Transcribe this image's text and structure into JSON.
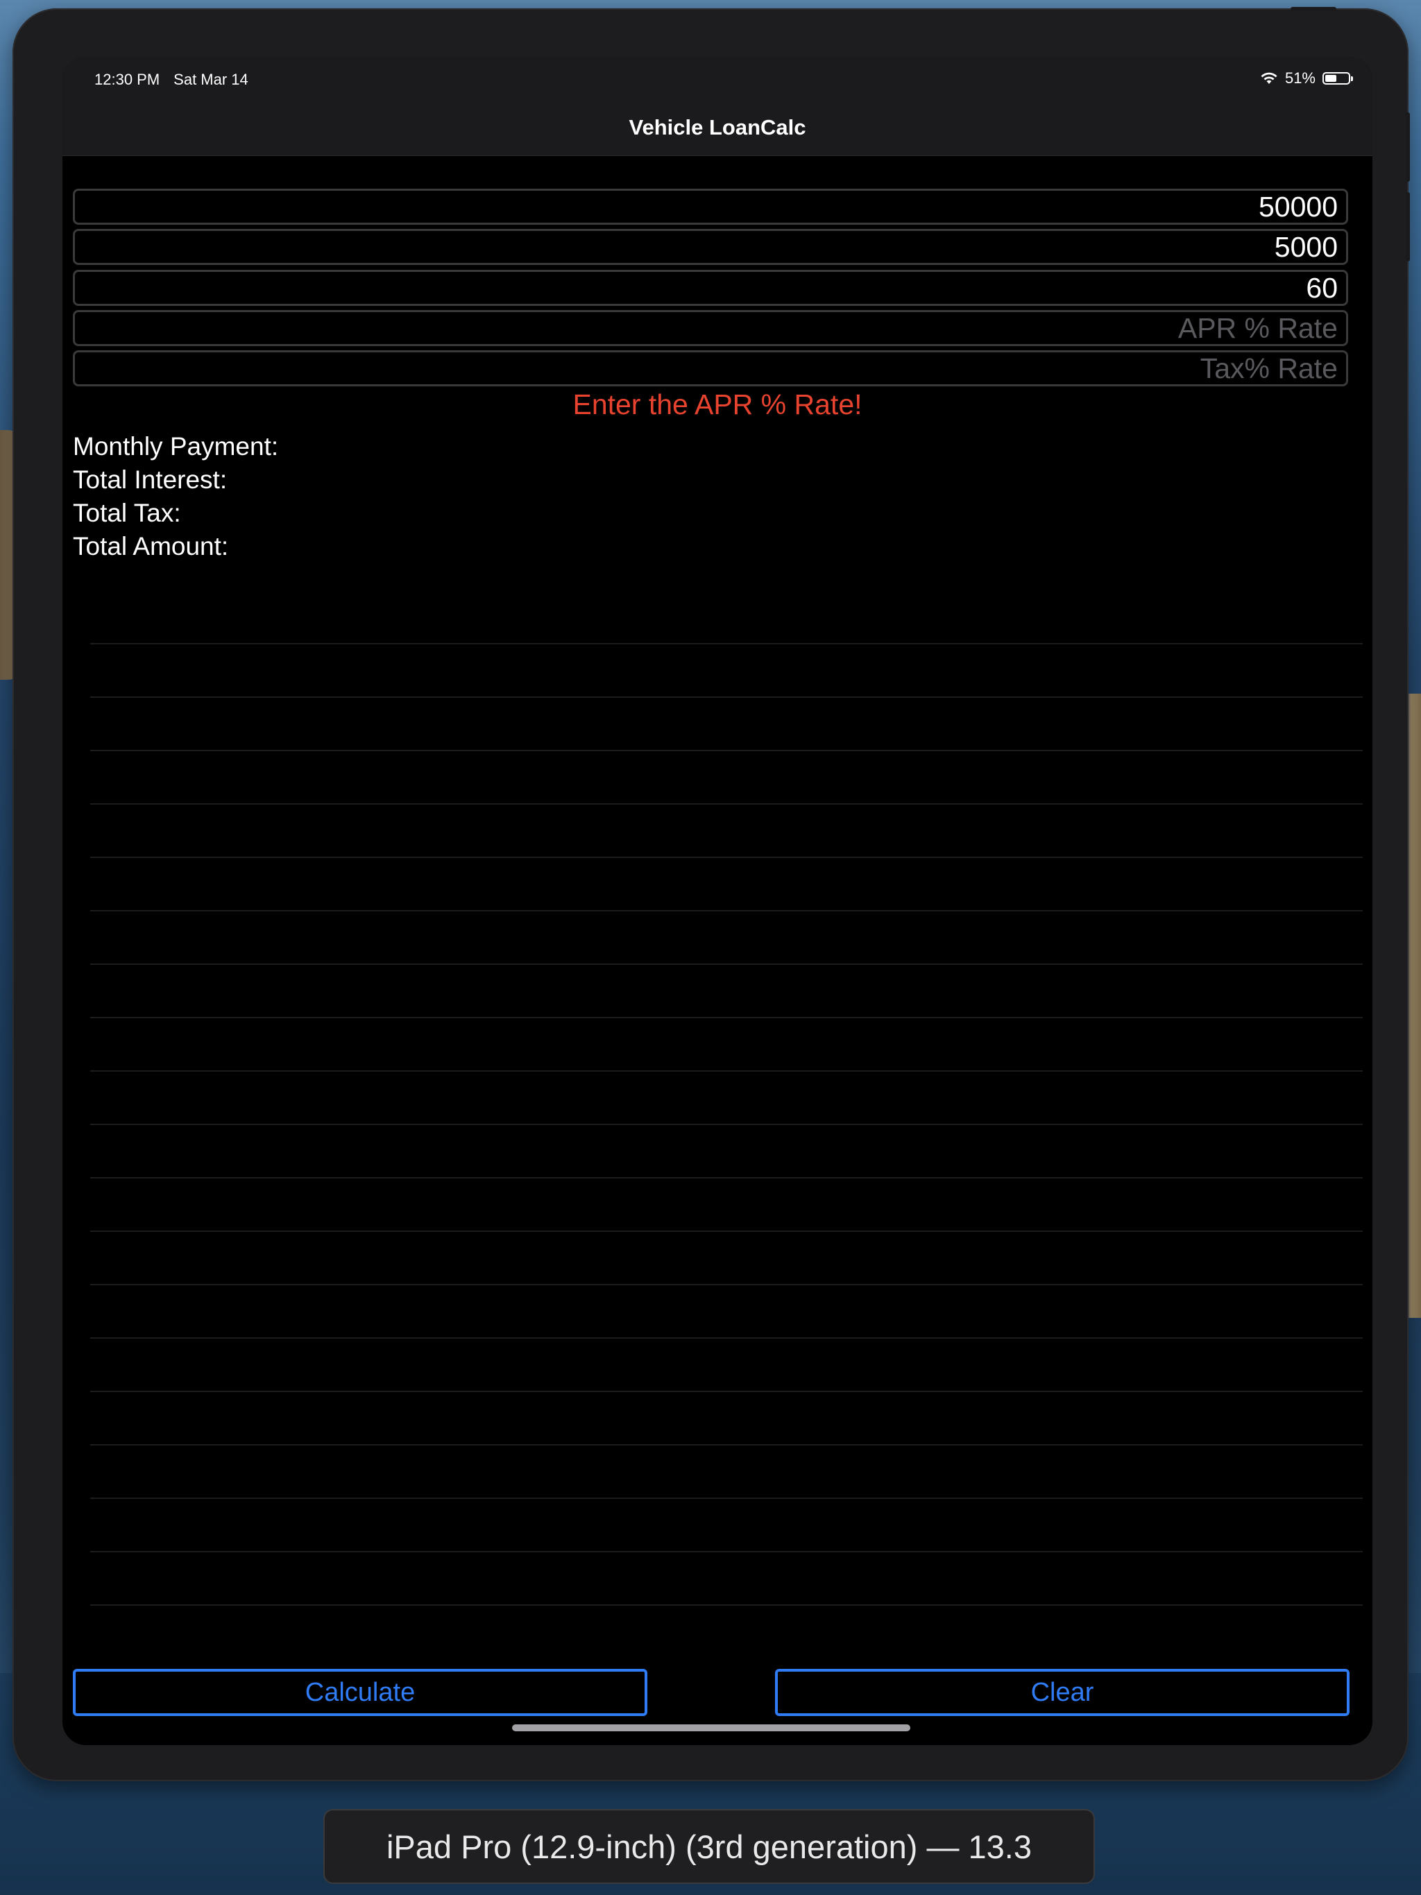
{
  "status_bar": {
    "time": "12:30 PM",
    "date": "Sat Mar 14",
    "battery_percent": "51%",
    "battery_level": 0.51
  },
  "nav": {
    "title": "Vehicle LoanCalc"
  },
  "fields": [
    {
      "value": "50000",
      "placeholder": ""
    },
    {
      "value": "5000",
      "placeholder": ""
    },
    {
      "value": "60",
      "placeholder": ""
    },
    {
      "value": "",
      "placeholder": "APR % Rate"
    },
    {
      "value": "",
      "placeholder": "Tax% Rate"
    }
  ],
  "error_message": "Enter the APR % Rate!",
  "results": {
    "monthly_payment_label": "Monthly Payment:",
    "total_interest_label": "Total Interest:",
    "total_tax_label": "Total Tax:",
    "total_amount_label": "Total Amount:"
  },
  "buttons": {
    "calculate": "Calculate",
    "clear": "Clear"
  },
  "simulator_label": "iPad Pro (12.9-inch) (3rd generation) — 13.3",
  "colors": {
    "accent": "#2f7cf6",
    "error": "#e8432e"
  }
}
